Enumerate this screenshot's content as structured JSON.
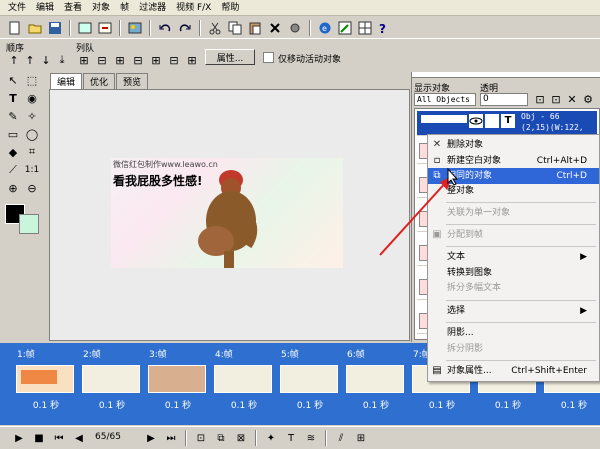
{
  "menu": [
    "文件",
    "编辑",
    "查看",
    "对象",
    "帧",
    "过滤器",
    "视频 F/X",
    "帮助"
  ],
  "sequence": {
    "order_label": "顺序",
    "arrange_label": "列队",
    "properties_button": "属性...",
    "move_active_label": "仅移动活动对象"
  },
  "tabs": [
    "编辑",
    "优化",
    "预览"
  ],
  "image": {
    "top_text": "微信红包制作www.leawo.cn",
    "main_text": "看我屁股多性感!"
  },
  "right_panel": {
    "show_objects_label": "显示对象",
    "transparency_label": "透明",
    "show_select_value": "All Objects",
    "transparency_value": "0",
    "selected_obj_name": "Obj - 66",
    "selected_obj_pos": "(2,15)(W:122,"
  },
  "context_menu": [
    {
      "label": "删除对象",
      "shortcut": "",
      "icon": "x-icon",
      "state": "normal"
    },
    {
      "label": "新建空白对象",
      "shortcut": "Ctrl+Alt+D",
      "icon": "new-object-icon",
      "state": "normal"
    },
    {
      "label": "相同的对象",
      "shortcut": "Ctrl+D",
      "icon": "duplicate-icon",
      "state": "highlighted"
    },
    {
      "label": "整对象",
      "shortcut": "",
      "icon": "",
      "state": "normal"
    },
    {
      "label": "关联为单一对象",
      "shortcut": "",
      "icon": "",
      "state": "disabled"
    },
    {
      "label": "分配到帧",
      "shortcut": "",
      "icon": "assign-icon",
      "state": "disabled"
    },
    {
      "label": "文本",
      "shortcut": "▶",
      "icon": "",
      "state": "normal"
    },
    {
      "label": "转换到图象",
      "shortcut": "",
      "icon": "",
      "state": "normal"
    },
    {
      "label": "拆分多幅文本",
      "shortcut": "",
      "icon": "",
      "state": "disabled"
    },
    {
      "label": "选择",
      "shortcut": "▶",
      "icon": "",
      "state": "normal"
    },
    {
      "label": "阴影...",
      "shortcut": "",
      "icon": "",
      "state": "normal"
    },
    {
      "label": "拆分阴影",
      "shortcut": "",
      "icon": "",
      "state": "disabled"
    },
    {
      "label": "对象属性...",
      "shortcut": "Ctrl+Shift+Enter",
      "icon": "properties-icon",
      "state": "normal"
    }
  ],
  "timeline": {
    "frames": [
      {
        "label": "1:帧",
        "delay": "0.1 秒"
      },
      {
        "label": "2:帧",
        "delay": "0.1 秒"
      },
      {
        "label": "3:帧",
        "delay": "0.1 秒"
      },
      {
        "label": "4:帧",
        "delay": "0.1 秒"
      },
      {
        "label": "5:帧",
        "delay": "0.1 秒"
      },
      {
        "label": "6:帧",
        "delay": "0.1 秒"
      },
      {
        "label": "7:帧",
        "delay": "0.1 秒"
      },
      {
        "label": "",
        "delay": "0.1 秒"
      },
      {
        "label": "",
        "delay": "0.1 秒"
      }
    ]
  },
  "status": {
    "frame_counter": "65/65"
  }
}
